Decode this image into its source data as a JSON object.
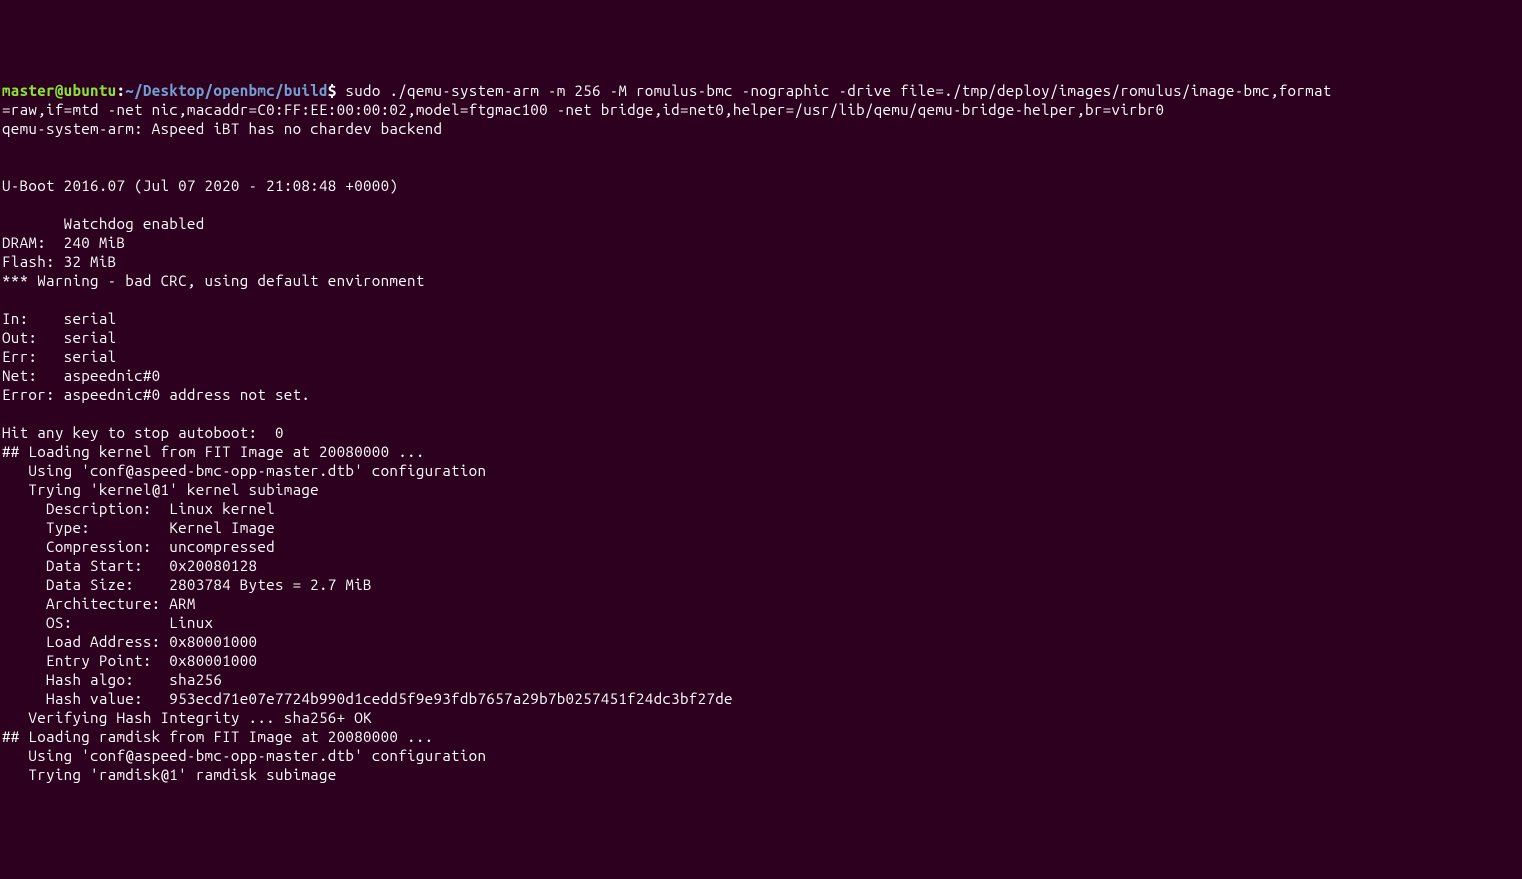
{
  "prompt": {
    "user": "master@ubuntu",
    "colon": ":",
    "path": "~/Desktop/openbmc/build",
    "dollar": "$ "
  },
  "command": {
    "line1": "sudo ./qemu-system-arm -m 256 -M romulus-bmc -nographic -drive file=./tmp/deploy/images/romulus/image-bmc,format",
    "line2": "=raw,if=mtd -net nic,macaddr=C0:FF:EE:00:00:02,model=ftgmac100 -net bridge,id=net0,helper=/usr/lib/qemu/qemu-bridge-helper,br=virbr0"
  },
  "output": {
    "l01": "qemu-system-arm: Aspeed iBT has no chardev backend",
    "l02": "",
    "l03": "",
    "l04": "U-Boot 2016.07 (Jul 07 2020 - 21:08:48 +0000)",
    "l05": "",
    "l06": "       Watchdog enabled",
    "l07": "DRAM:  240 MiB",
    "l08": "Flash: 32 MiB",
    "l09": "*** Warning - bad CRC, using default environment",
    "l10": "",
    "l11": "In:    serial",
    "l12": "Out:   serial",
    "l13": "Err:   serial",
    "l14": "Net:   aspeednic#0",
    "l15": "Error: aspeednic#0 address not set.",
    "l16": "",
    "l17": "Hit any key to stop autoboot:  0 ",
    "l18": "## Loading kernel from FIT Image at 20080000 ...",
    "l19": "   Using 'conf@aspeed-bmc-opp-master.dtb' configuration",
    "l20": "   Trying 'kernel@1' kernel subimage",
    "l21": "     Description:  Linux kernel",
    "l22": "     Type:         Kernel Image",
    "l23": "     Compression:  uncompressed",
    "l24": "     Data Start:   0x20080128",
    "l25": "     Data Size:    2803784 Bytes = 2.7 MiB",
    "l26": "     Architecture: ARM",
    "l27": "     OS:           Linux",
    "l28": "     Load Address: 0x80001000",
    "l29": "     Entry Point:  0x80001000",
    "l30": "     Hash algo:    sha256",
    "l31": "     Hash value:   953ecd71e07e7724b990d1cedd5f9e93fdb7657a29b7b0257451f24dc3bf27de",
    "l32": "   Verifying Hash Integrity ... sha256+ OK",
    "l33": "## Loading ramdisk from FIT Image at 20080000 ...",
    "l34": "   Using 'conf@aspeed-bmc-opp-master.dtb' configuration",
    "l35": "   Trying 'ramdisk@1' ramdisk subimage"
  }
}
